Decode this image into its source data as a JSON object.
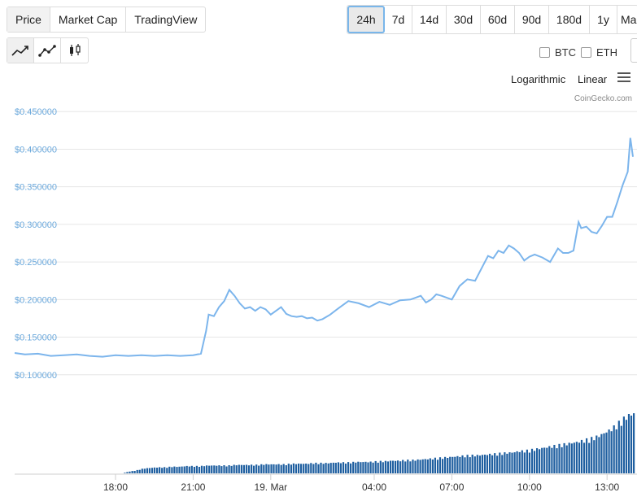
{
  "metric_tabs": [
    {
      "label": "Price",
      "active": true
    },
    {
      "label": "Market Cap",
      "active": false
    },
    {
      "label": "TradingView",
      "active": false
    }
  ],
  "range_tabs": [
    {
      "label": "24h",
      "active": true
    },
    {
      "label": "7d",
      "active": false
    },
    {
      "label": "14d",
      "active": false
    },
    {
      "label": "30d",
      "active": false
    },
    {
      "label": "60d",
      "active": false
    },
    {
      "label": "90d",
      "active": false
    },
    {
      "label": "180d",
      "active": false
    },
    {
      "label": "1y",
      "active": false
    },
    {
      "label": "Ma",
      "active": false
    }
  ],
  "chart_type_icons": [
    "line-chart-icon",
    "line-markers-chart-icon",
    "candlestick-chart-icon"
  ],
  "compare": [
    {
      "label": "BTC",
      "checked": false
    },
    {
      "label": "ETH",
      "checked": false
    }
  ],
  "scale": {
    "logarithmic": "Logarithmic",
    "linear": "Linear"
  },
  "credit": "CoinGecko.com",
  "colors": {
    "line": "#7cb5ec",
    "volume": "#1f5fa0",
    "axis_label": "#6aa8dc"
  },
  "chart_data": {
    "type": "line",
    "title": "",
    "xlabel": "",
    "ylabel": "",
    "ylim": [
      0.09,
      0.46
    ],
    "grid": true,
    "y_ticks": [
      "$0.450000",
      "$0.400000",
      "$0.350000",
      "$0.300000",
      "$0.250000",
      "$0.200000",
      "$0.150000",
      "$0.100000"
    ],
    "y_tick_values": [
      0.45,
      0.4,
      0.35,
      0.3,
      0.25,
      0.2,
      0.15,
      0.1
    ],
    "x_ticks": [
      "18:00",
      "21:00",
      "19. Mar",
      "04:00",
      "07:00",
      "10:00",
      "13:00"
    ],
    "x_tick_hours": [
      18,
      21,
      24,
      28,
      31,
      34,
      37
    ],
    "x_range_hours": [
      14.1,
      38.0
    ],
    "series": [
      {
        "x": [
          14.1,
          14.5,
          15.0,
          15.5,
          16.0,
          16.5,
          17.0,
          17.5,
          18.0,
          18.5,
          19.0,
          19.5,
          20.0,
          20.5,
          21.0,
          21.3,
          21.5,
          21.6,
          21.8,
          22.0,
          22.2,
          22.4,
          22.6,
          22.8,
          23.0,
          23.2,
          23.4,
          23.6,
          23.8,
          24.0,
          24.2,
          24.4,
          24.6,
          24.8,
          25.0,
          25.2,
          25.4,
          25.6,
          25.8,
          26.0,
          26.3,
          26.6,
          27.0,
          27.4,
          27.8,
          28.2,
          28.6,
          29.0,
          29.4,
          29.8,
          30.0,
          30.2,
          30.4,
          30.6,
          31.0,
          31.3,
          31.6,
          31.9,
          32.2,
          32.4,
          32.6,
          32.8,
          33.0,
          33.2,
          33.4,
          33.6,
          33.8,
          34.0,
          34.2,
          34.5,
          34.8,
          35.1,
          35.3,
          35.5,
          35.7,
          35.9,
          36.0,
          36.2,
          36.4,
          36.6,
          36.8,
          37.0,
          37.2,
          37.4,
          37.6,
          37.8,
          37.9,
          38.0
        ],
        "y": [
          0.129,
          0.127,
          0.128,
          0.125,
          0.126,
          0.127,
          0.125,
          0.124,
          0.126,
          0.125,
          0.126,
          0.125,
          0.126,
          0.125,
          0.126,
          0.128,
          0.158,
          0.18,
          0.178,
          0.19,
          0.198,
          0.213,
          0.205,
          0.195,
          0.188,
          0.19,
          0.185,
          0.19,
          0.187,
          0.18,
          0.185,
          0.19,
          0.181,
          0.178,
          0.177,
          0.178,
          0.175,
          0.176,
          0.172,
          0.174,
          0.18,
          0.188,
          0.198,
          0.195,
          0.19,
          0.197,
          0.193,
          0.199,
          0.2,
          0.205,
          0.196,
          0.2,
          0.207,
          0.205,
          0.2,
          0.218,
          0.227,
          0.225,
          0.245,
          0.258,
          0.255,
          0.265,
          0.262,
          0.272,
          0.268,
          0.262,
          0.252,
          0.257,
          0.26,
          0.256,
          0.25,
          0.268,
          0.262,
          0.262,
          0.265,
          0.303,
          0.295,
          0.297,
          0.29,
          0.288,
          0.298,
          0.31,
          0.31,
          0.33,
          0.352,
          0.37,
          0.415,
          0.39
        ]
      }
    ],
    "volume_note": "volume bars shown below price series; relative heights only (no axis printed)",
    "volume_relative": [
      0.0,
      0.0,
      0.0,
      0.0,
      0.0,
      0.0,
      0.0,
      0.0,
      0.0,
      0.0,
      0.0,
      0.0,
      0.0,
      0.0,
      0.0,
      0.0,
      0.03,
      0.05,
      0.08,
      0.09,
      0.1,
      0.1,
      0.11,
      0.11,
      0.12,
      0.12,
      0.12,
      0.13,
      0.13,
      0.13,
      0.13,
      0.14,
      0.14,
      0.14,
      0.14,
      0.15,
      0.15,
      0.15,
      0.15,
      0.16,
      0.16,
      0.16,
      0.17,
      0.17,
      0.17,
      0.18,
      0.18,
      0.18,
      0.19,
      0.19,
      0.19,
      0.2,
      0.2,
      0.21,
      0.21,
      0.22,
      0.22,
      0.23,
      0.24,
      0.25,
      0.26,
      0.27,
      0.28,
      0.29,
      0.3,
      0.3,
      0.31,
      0.32,
      0.33,
      0.34,
      0.35,
      0.37,
      0.38,
      0.4,
      0.42,
      0.44,
      0.46,
      0.48,
      0.5,
      0.52,
      0.55,
      0.58,
      0.62,
      0.68,
      0.75,
      0.85,
      0.95,
      1.0
    ]
  }
}
